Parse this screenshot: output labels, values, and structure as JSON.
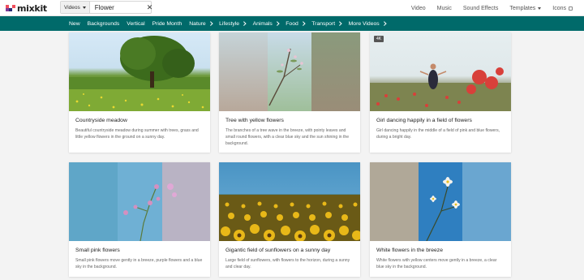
{
  "logo": {
    "text": "mixkit"
  },
  "search": {
    "category": "Videos",
    "query": "Flower"
  },
  "topnav": [
    {
      "label": "Video"
    },
    {
      "label": "Music"
    },
    {
      "label": "Sound Effects"
    },
    {
      "label": "Templates"
    },
    {
      "label": "Icons"
    }
  ],
  "categories": [
    {
      "label": "New"
    },
    {
      "label": "Backgrounds"
    },
    {
      "label": "Vertical"
    },
    {
      "label": "Pride Month"
    },
    {
      "label": "Nature"
    },
    {
      "label": "Lifestyle"
    },
    {
      "label": "Animals"
    },
    {
      "label": "Food"
    },
    {
      "label": "Transport"
    },
    {
      "label": "More Videos"
    }
  ],
  "cards": [
    {
      "title": "Countryside meadow",
      "desc": "Beautiful countryside meadow during summer with trees, grass and little yellow flowers in the ground on a sunny day."
    },
    {
      "title": "Tree with yellow flowers",
      "desc": "The branches of a tree wave in the breeze, with pointy leaves and small round flowers, with a clear blue sky and the sun shining in the background."
    },
    {
      "title": "Girl dancing happily in a field of flowers",
      "desc": "Girl dancing happily in the middle of a field of pink and blue flowers, during a bright day.",
      "badge": "4K"
    },
    {
      "title": "Small pink flowers",
      "desc": "Small pink flowers move gently in a breeze, purple flowers and a blue sky in the background."
    },
    {
      "title": "Gigantic field of sunflowers on a sunny day",
      "desc": "Large field of sunflowers, with flowers to the horizon, during a sunny and clear day."
    },
    {
      "title": "White flowers in the breeze",
      "desc": "White flowers with yellow centers move gently in a breeze, a clear blue sky in the background."
    }
  ]
}
